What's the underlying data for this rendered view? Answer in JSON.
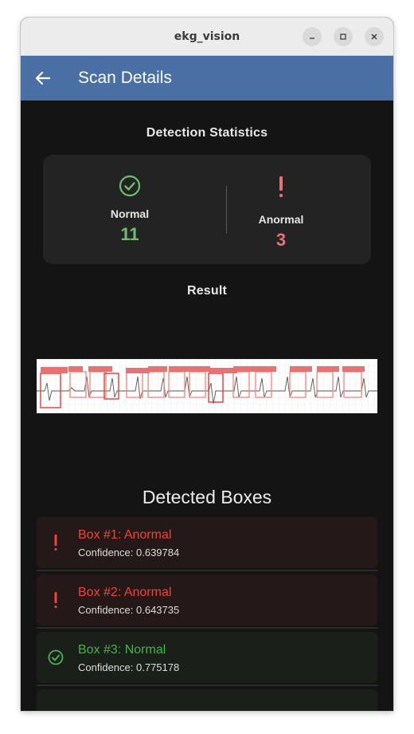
{
  "window": {
    "title": "ekg_vision"
  },
  "appbar": {
    "title": "Scan Details"
  },
  "stats": {
    "heading": "Detection Statistics",
    "normal": {
      "label": "Normal",
      "value": "11",
      "color": "#6fbf73"
    },
    "anormal": {
      "label": "Anormal",
      "value": "3",
      "color": "#e57373"
    }
  },
  "result": {
    "heading": "Result"
  },
  "boxes": {
    "heading": "Detected Boxes",
    "items": [
      {
        "title": "Box #1: Anormal",
        "confidence": "Confidence: 0.639784",
        "status": "anormal",
        "icon": "exclamation-icon"
      },
      {
        "title": "Box #2: Anormal",
        "confidence": "Confidence: 0.643735",
        "status": "anormal",
        "icon": "exclamation-icon"
      },
      {
        "title": "Box #3: Normal",
        "confidence": "Confidence: 0.775178",
        "status": "normal",
        "icon": "check-circle-icon"
      }
    ]
  },
  "colors": {
    "appbar": "#4a6fa5",
    "normal": "#6fbf73",
    "anormal": "#f44336"
  }
}
